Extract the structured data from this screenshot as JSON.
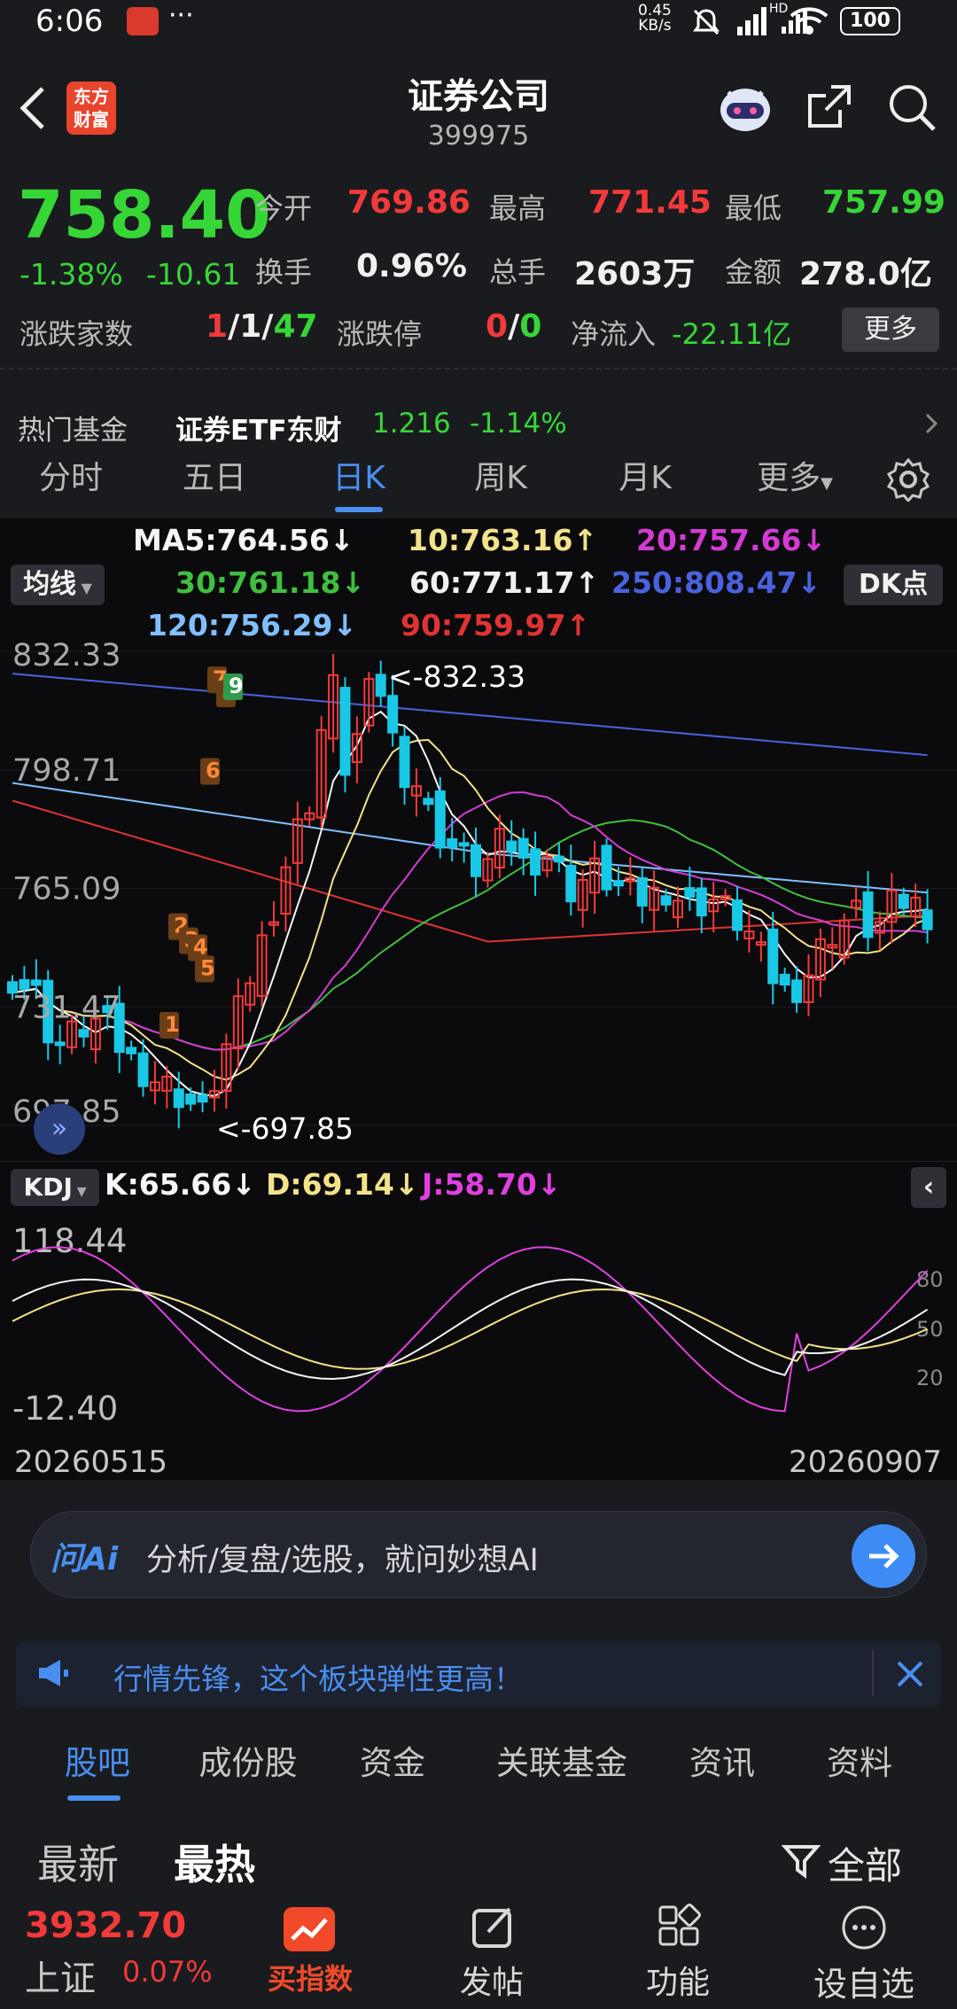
{
  "status": {
    "time": "6:06",
    "dots": "···",
    "net_speed": "0.45",
    "net_unit": "KB/s",
    "hd": "HD",
    "battery": "100"
  },
  "header": {
    "logo_line1": "东方",
    "logo_line2": "财富",
    "title": "证券公司",
    "code": "399975"
  },
  "quote": {
    "price": "758.40",
    "change_pct": "-1.38%",
    "change": "-10.61",
    "open_label": "今开",
    "open": "769.86",
    "high_label": "最高",
    "high": "771.45",
    "low_label": "最低",
    "low": "757.99",
    "turnover_label": "换手",
    "turnover": "0.96%",
    "volume_label": "总手",
    "volume": "2603万",
    "amount_label": "金额",
    "amount": "278.0亿",
    "breadth_label": "涨跌家数",
    "breadth_up": "1",
    "breadth_flat": "1",
    "breadth_down": "47",
    "limit_label": "涨跌停",
    "limit_up": "0",
    "limit_down": "0",
    "inflow_label": "净流入",
    "inflow": "-22.11亿",
    "more": "更多"
  },
  "fund": {
    "label": "热门基金",
    "name": "证券ETF东财",
    "price": "1.216",
    "pct": "-1.14%"
  },
  "tabs": [
    "分时",
    "五日",
    "日K",
    "周K",
    "月K",
    "更多"
  ],
  "ma": {
    "ma5": "MA5:764.56↓",
    "ma10": "10:763.16↑",
    "ma20": "20:757.66↓",
    "ma30": "30:761.18↓",
    "ma60": "60:771.17↑",
    "ma250": "250:808.47↓",
    "ma120": "120:756.29↓",
    "ma90": "90:759.97↑",
    "button": "均线",
    "dk": "DK点"
  },
  "chart_data": {
    "type": "candlestick",
    "y_labels": [
      "832.33",
      "798.71",
      "765.09",
      "731.47",
      "697.85"
    ],
    "high_marker": "<-832.33",
    "low_marker": "<-697.85",
    "ylim": [
      697.85,
      832.33
    ],
    "td_counts": [
      "1",
      "2",
      "3",
      "4",
      "5",
      "6",
      "7",
      "8",
      "9"
    ],
    "colors": {
      "up": "#f23a3a",
      "down": "#19c8e6",
      "ma5": "#f5f5f5",
      "ma10": "#f2e28a",
      "ma20": "#d43bd4",
      "ma30": "#3fbf3f",
      "ma60": "#f0f0f0",
      "ma90": "#e03333",
      "ma120": "#80bfff",
      "ma250": "#4a62e0"
    }
  },
  "kdj": {
    "button": "KDJ",
    "k": "K:65.66↓",
    "d": "D:69.14↓",
    "j": "J:58.70↓",
    "y_top": "118.44",
    "y_bottom": "-12.40",
    "levels": [
      "80",
      "50",
      "20"
    ],
    "date_start": "20260515",
    "date_end": "20260907"
  },
  "ai": {
    "logo": "问Ai",
    "placeholder": "分析/复盘/选股，就问妙想AI"
  },
  "notice": {
    "text": "行情先锋，这个板块弹性更高！"
  },
  "bottom_tabs": [
    "股吧",
    "成份股",
    "资金",
    "关联基金",
    "资讯",
    "资料"
  ],
  "sort": {
    "latest": "最新",
    "hot": "最热",
    "filter": "全部"
  },
  "nav": {
    "index_value": "3932.70",
    "index_name": "上证",
    "index_pct": "0.07%",
    "buy": "买指数",
    "post": "发帖",
    "func": "功能",
    "watch": "设自选"
  }
}
